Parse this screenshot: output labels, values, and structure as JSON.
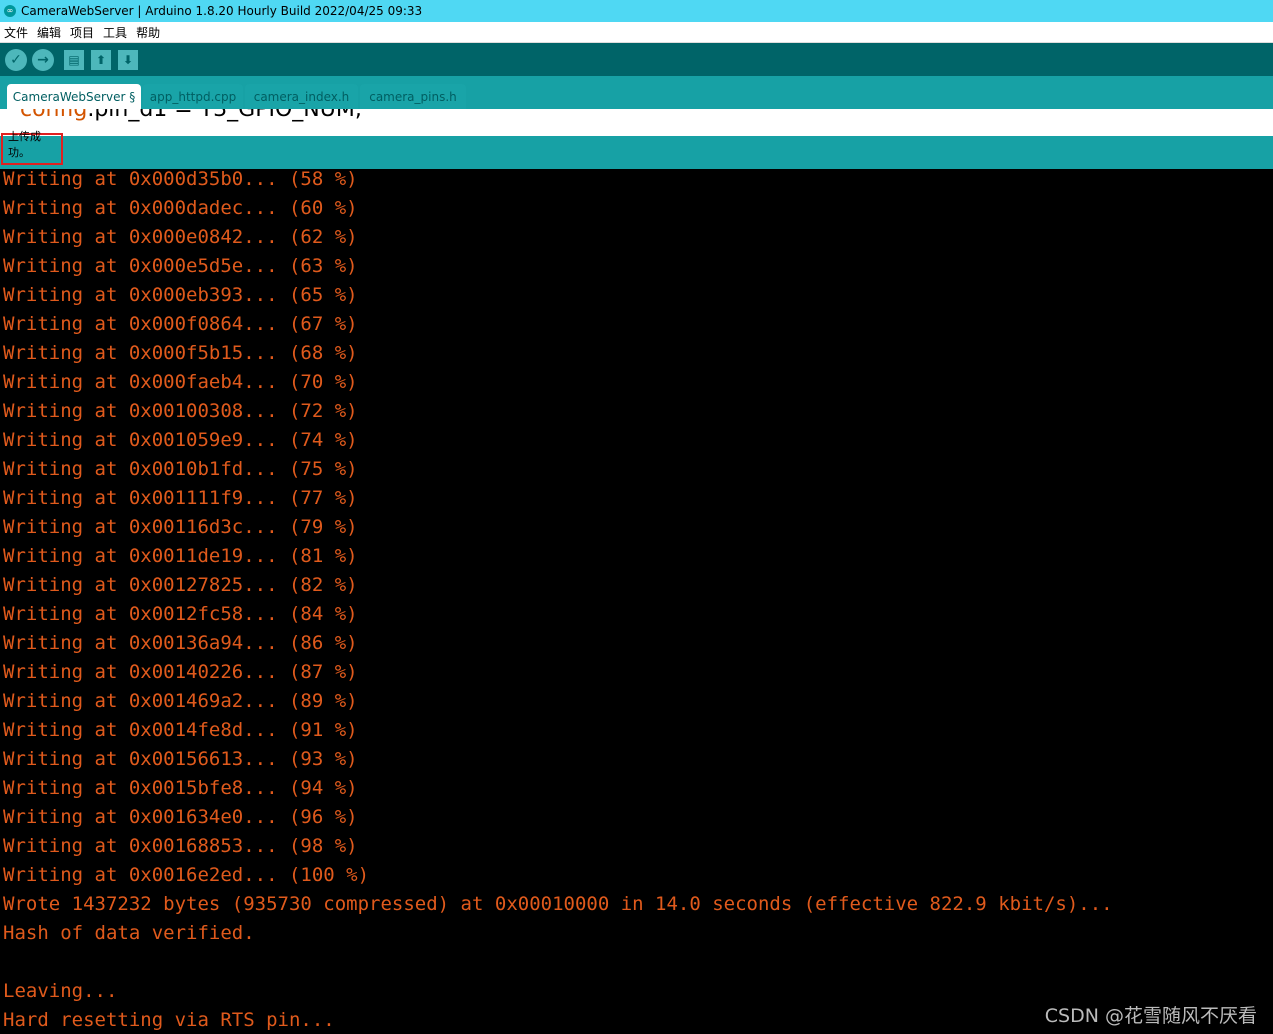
{
  "window": {
    "title": "CameraWebServer | Arduino 1.8.20 Hourly Build 2022/04/25 09:33",
    "app_icon": "∞"
  },
  "menu": [
    "文件",
    "编辑",
    "项目",
    "工具",
    "帮助"
  ],
  "toolbar": {
    "buttons": [
      {
        "name": "verify",
        "icon": "check-icon",
        "glyph": "✓"
      },
      {
        "name": "upload",
        "icon": "arrow-right-icon",
        "glyph": "→"
      },
      {
        "name": "new",
        "icon": "new-file-icon",
        "glyph": "▤"
      },
      {
        "name": "open",
        "icon": "arrow-up-icon",
        "glyph": "⬆"
      },
      {
        "name": "save",
        "icon": "arrow-down-icon",
        "glyph": "⬇"
      }
    ]
  },
  "tabs": [
    {
      "label": "CameraWebServer §",
      "active": true
    },
    {
      "label": "app_httpd.cpp",
      "active": false
    },
    {
      "label": "camera_index.h",
      "active": false
    },
    {
      "label": "camera_pins.h",
      "active": false
    }
  ],
  "editor": {
    "visible_object": "config",
    "visible_rest": ".pin_d1 = Y3_GPIO_NUM;"
  },
  "status": {
    "message": "上传成功。"
  },
  "console": {
    "lines": [
      "Writing at 0x000d35b0... (58 %)",
      "Writing at 0x000dadec... (60 %)",
      "Writing at 0x000e0842... (62 %)",
      "Writing at 0x000e5d5e... (63 %)",
      "Writing at 0x000eb393... (65 %)",
      "Writing at 0x000f0864... (67 %)",
      "Writing at 0x000f5b15... (68 %)",
      "Writing at 0x000faeb4... (70 %)",
      "Writing at 0x00100308... (72 %)",
      "Writing at 0x001059e9... (74 %)",
      "Writing at 0x0010b1fd... (75 %)",
      "Writing at 0x001111f9... (77 %)",
      "Writing at 0x00116d3c... (79 %)",
      "Writing at 0x0011de19... (81 %)",
      "Writing at 0x00127825... (82 %)",
      "Writing at 0x0012fc58... (84 %)",
      "Writing at 0x00136a94... (86 %)",
      "Writing at 0x00140226... (87 %)",
      "Writing at 0x001469a2... (89 %)",
      "Writing at 0x0014fe8d... (91 %)",
      "Writing at 0x00156613... (93 %)",
      "Writing at 0x0015bfe8... (94 %)",
      "Writing at 0x001634e0... (96 %)",
      "Writing at 0x00168853... (98 %)",
      "Writing at 0x0016e2ed... (100 %)",
      "Wrote 1437232 bytes (935730 compressed) at 0x00010000 in 14.0 seconds (effective 822.9 kbit/s)...",
      "Hash of data verified.",
      "",
      "Leaving...",
      "Hard resetting via RTS pin..."
    ]
  },
  "watermark": "CSDN @花雪随风不厌看",
  "colors": {
    "title_bar": "#4fd8f3",
    "toolbar": "#006468",
    "tabs_bar": "#17a1a5",
    "console_text": "#e05a1c",
    "highlight_box": "#e02020"
  }
}
